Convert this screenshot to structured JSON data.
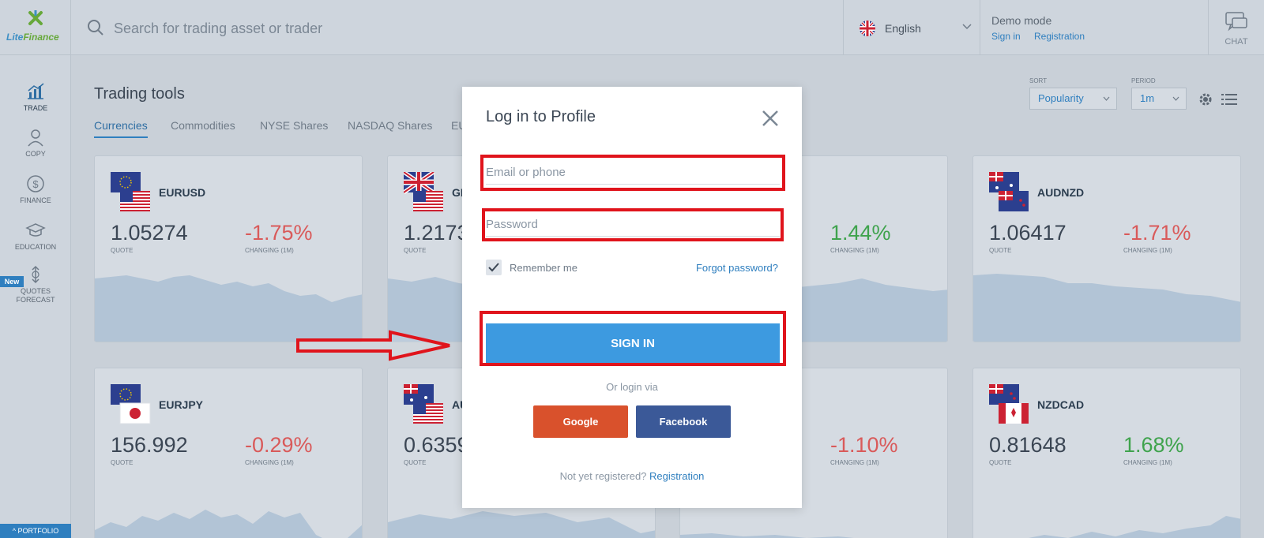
{
  "header": {
    "logo_text_a": "Lite",
    "logo_text_b": "Finance",
    "search_placeholder": "Search for trading asset or trader",
    "language": "English",
    "demo_title": "Demo mode",
    "sign_in_link": "Sign in",
    "registration_link": "Registration",
    "chat_label": "CHAT"
  },
  "sidebar": {
    "items": [
      {
        "label": "TRADE",
        "icon": "chart-icon"
      },
      {
        "label": "COPY",
        "icon": "trader-icon"
      },
      {
        "label": "FINANCE",
        "icon": "dollar-icon"
      },
      {
        "label": "EDUCATION",
        "icon": "graduation-cap-icon"
      },
      {
        "label": "QUOTES",
        "label2": "FORECAST",
        "icon": "forecast-icon"
      }
    ],
    "new_badge": "New",
    "portfolio": "PORTFOLIO"
  },
  "main": {
    "title": "Trading tools",
    "tabs": [
      "Currencies",
      "Commodities",
      "NYSE Shares",
      "NASDAQ Shares",
      "EU"
    ],
    "sort_label": "SORT",
    "sort_value": "Popularity",
    "period_label": "PERIOD",
    "period_value": "1m"
  },
  "cards": [
    {
      "pair": "EURUSD",
      "quote": "1.05274",
      "quote_label": "QUOTE",
      "change": "-1.75%",
      "change_label": "CHANGING (1M)"
    },
    {
      "pair": "GB",
      "quote": "1.2173",
      "quote_label": "QUOTE",
      "change": "",
      "change_label": ""
    },
    {
      "pair": "",
      "quote": "",
      "quote_label": "",
      "change": "1.44%",
      "change_label": "CHANGING (1M)"
    },
    {
      "pair": "AUDNZD",
      "quote": "1.06417",
      "quote_label": "QUOTE",
      "change": "-1.71%",
      "change_label": "CHANGING (1M)"
    },
    {
      "pair": "EURJPY",
      "quote": "156.992",
      "quote_label": "QUOTE",
      "change": "-0.29%",
      "change_label": "CHANGING (1M)"
    },
    {
      "pair": "AU",
      "quote": "0.6359",
      "quote_label": "QUOTE",
      "change": "",
      "change_label": ""
    },
    {
      "pair": "",
      "quote": "",
      "quote_label": "",
      "change": "-1.10%",
      "change_label": "CHANGING (1M)"
    },
    {
      "pair": "NZDCAD",
      "quote": "0.81648",
      "quote_label": "QUOTE",
      "change": "1.68%",
      "change_label": "CHANGING (1M)"
    }
  ],
  "modal": {
    "title": "Log in to Profile",
    "email_placeholder": "Email or phone",
    "password_placeholder": "Password",
    "remember_me": "Remember me",
    "remember_checked": true,
    "forgot_password": "Forgot password?",
    "sign_in_button": "SIGN IN",
    "or_login_via": "Or login via",
    "google_button": "Google",
    "facebook_button": "Facebook",
    "not_registered": "Not yet registered?",
    "registration_link": "Registration"
  },
  "colors": {
    "accent": "#3d9ae0",
    "highlight": "#e0141c",
    "google": "#d9512c",
    "facebook": "#3b5998",
    "negative": "#d95a5a",
    "positive": "#3fa34d"
  }
}
